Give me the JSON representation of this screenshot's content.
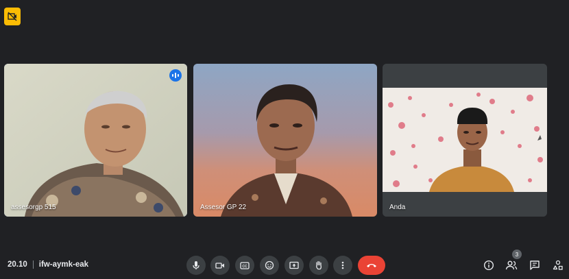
{
  "meeting": {
    "time": "20.10",
    "code": "ifw-aymk-eak"
  },
  "participants": [
    {
      "name": "assesorgp 515",
      "speaking": true
    },
    {
      "name": "Assesor GP 22",
      "speaking": false
    },
    {
      "name": "Anda",
      "speaking": false
    }
  ],
  "people_count": "3",
  "controls": [
    "mic-icon",
    "camera-icon",
    "captions-icon",
    "emoji-icon",
    "present-icon",
    "raise-hand-icon",
    "more-options-icon",
    "end-call-icon"
  ],
  "right_controls": [
    "info-icon",
    "people-icon",
    "chat-icon",
    "activities-icon"
  ],
  "colors": {
    "background": "#202124",
    "control": "#3c4043",
    "end_call": "#ea4335",
    "active_border": "#8ab4f8",
    "speaking_badge": "#1a73e8",
    "recording_badge": "#fbbc04"
  }
}
